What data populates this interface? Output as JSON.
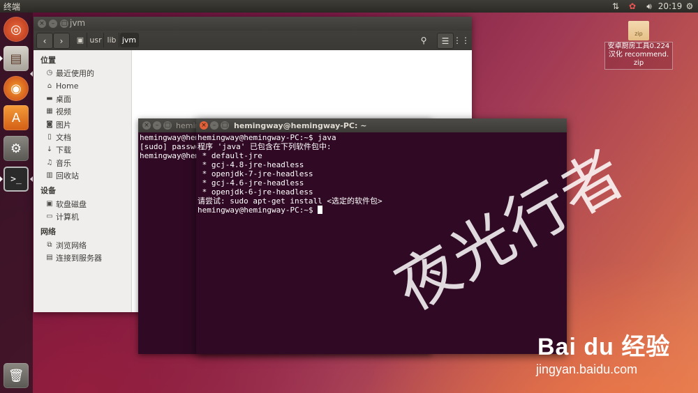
{
  "top_panel": {
    "app_title": "终端",
    "time": "20:19"
  },
  "launcher": {
    "items": [
      "ubuntu-dash-icon",
      "files-icon",
      "firefox-icon",
      "software-center-icon",
      "system-settings-icon",
      "terminal-icon",
      "trash-icon"
    ]
  },
  "file_manager": {
    "title": "jvm",
    "path": [
      "usr",
      "lib",
      "jvm"
    ],
    "sidebar": {
      "places_header": "位置",
      "places": [
        "最近使用的",
        "Home",
        "桌面",
        "视频",
        "图片",
        "文档",
        "下载",
        "音乐",
        "回收站"
      ],
      "devices_header": "设备",
      "devices": [
        "软盘磁盘",
        "计算机"
      ],
      "network_header": "网络",
      "network": [
        "浏览网络",
        "连接到服务器"
      ]
    }
  },
  "terminal_back": {
    "title": "hemingway@hemingway-PC: ~",
    "lines": [
      "hemingway@hem",
      "[sudo] passwo",
      "hemingway@hem"
    ]
  },
  "terminal_front": {
    "title": "hemingway@hemingway-PC: ~",
    "lines": [
      "hemingway@hemingway-PC:~$ java",
      "程序 'java' 已包含在下列软件包中:",
      " * default-jre",
      " * gcj-4.8-jre-headless",
      " * openjdk-7-jre-headless",
      " * gcj-4.6-jre-headless",
      " * openjdk-6-jre-headless",
      "请尝试: sudo apt-get install <选定的软件包>",
      "hemingway@hemingway-PC:~$ "
    ]
  },
  "desktop_icon": {
    "badge": "zip",
    "label_line1": "安卓厨房工具0.224",
    "label_line2": "汉化 recommend.",
    "label_line3": "zip"
  },
  "watermark": {
    "text": "夜光行者",
    "brand": "Bai du 经验",
    "url": "jingyan.baidu.com"
  }
}
